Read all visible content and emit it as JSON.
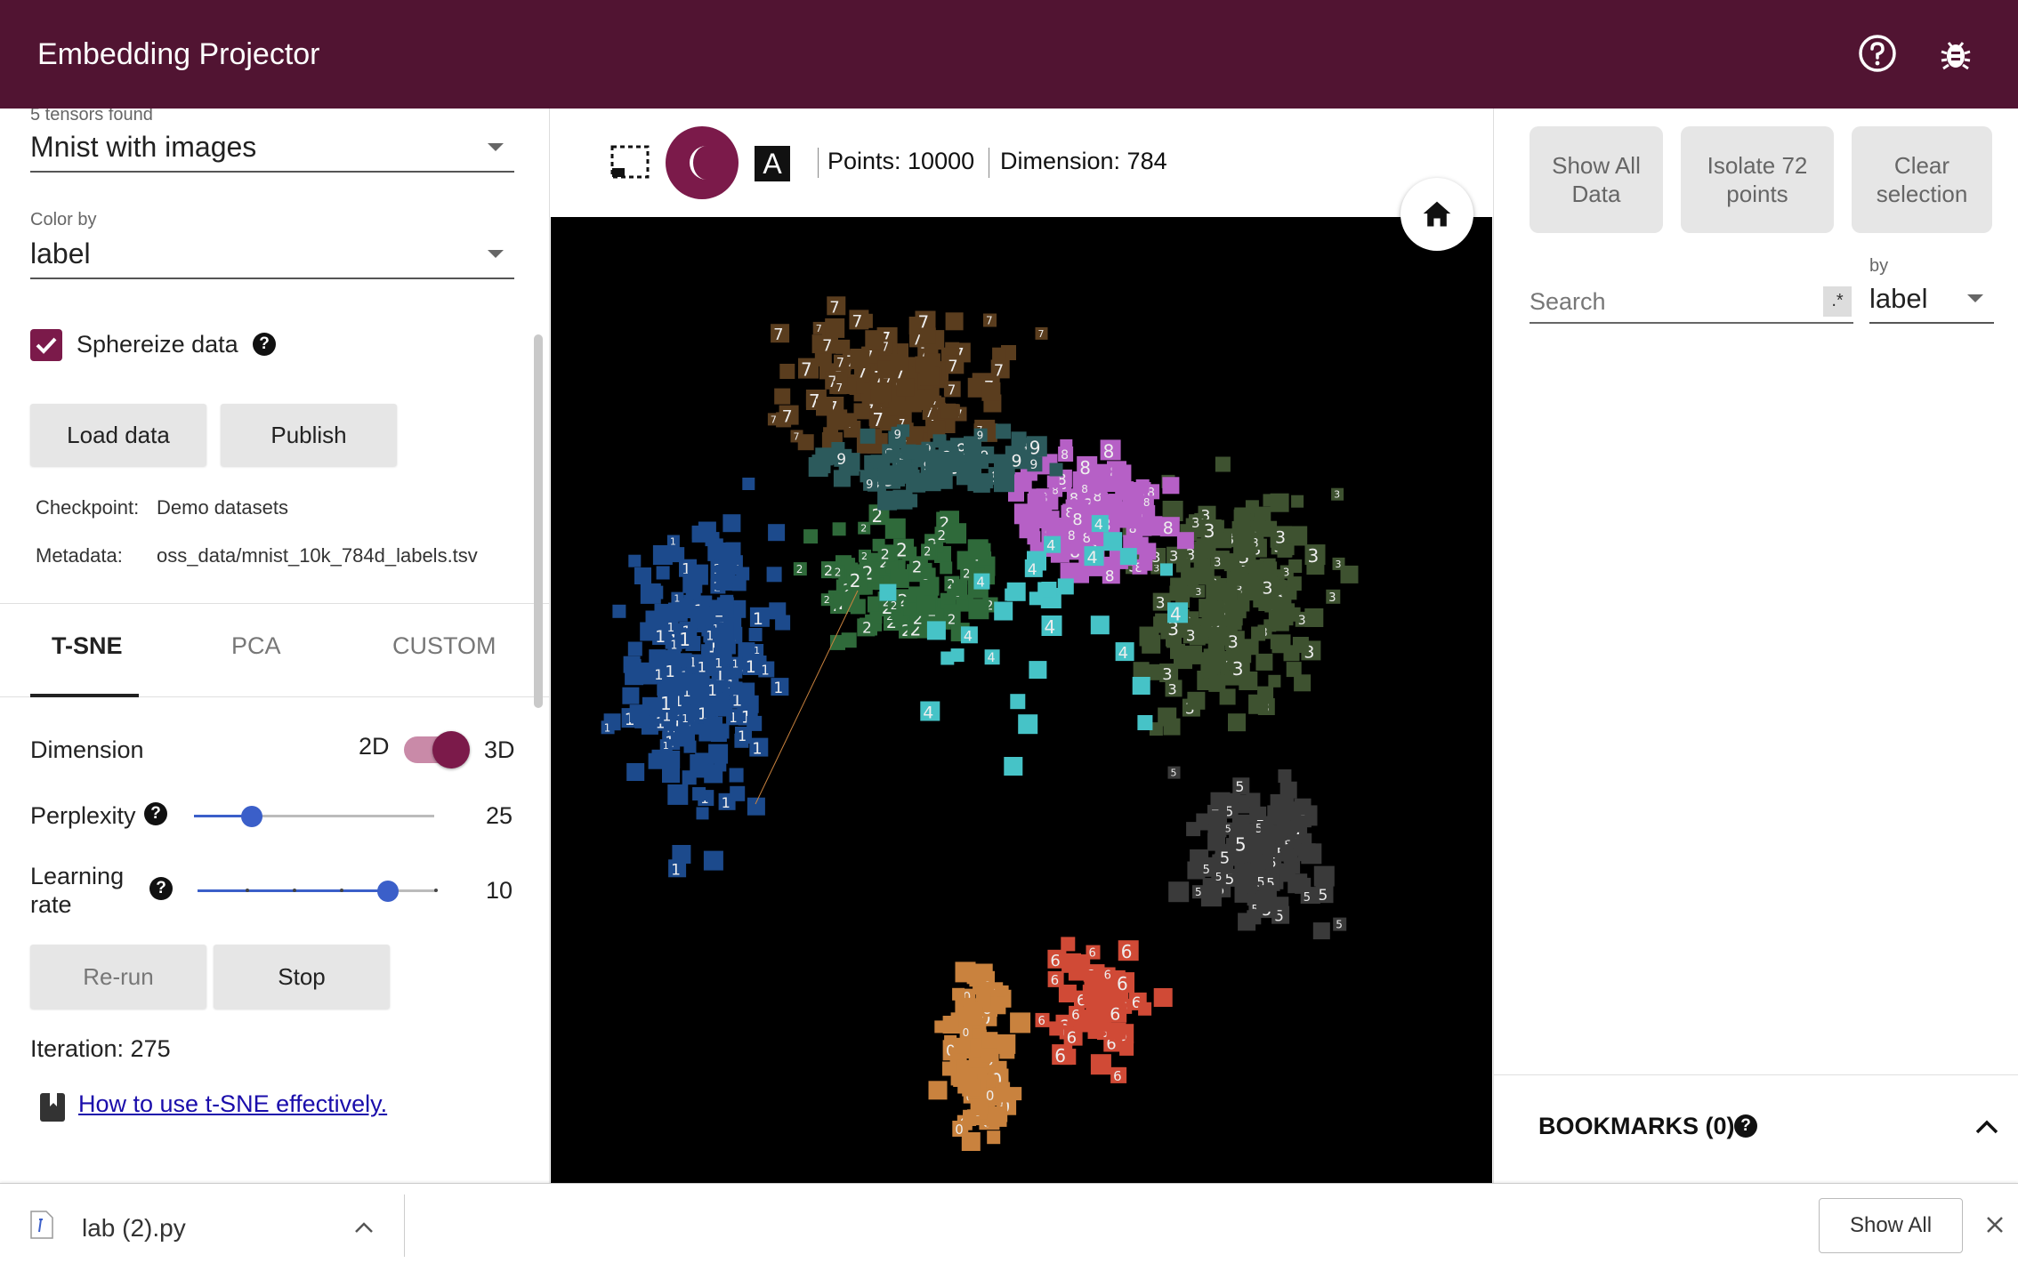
{
  "header": {
    "title": "Embedding Projector",
    "help_icon": "help-circle-icon",
    "bug_icon": "bug-icon"
  },
  "left": {
    "tensors_found": "5 tensors found",
    "tensor_select": "Mnist with images",
    "color_by_label": "Color by",
    "color_by_value": "label",
    "sphereize_label": "Sphereize data",
    "sphereize_checked": true,
    "load_button": "Load data",
    "publish_button": "Publish",
    "checkpoint_label": "Checkpoint:",
    "checkpoint_value": "Demo datasets",
    "metadata_label": "Metadata:",
    "metadata_value": "oss_data/mnist_10k_784d_labels.tsv",
    "tabs": [
      {
        "label": "T-SNE",
        "active": true
      },
      {
        "label": "PCA"
      },
      {
        "label": "CUSTOM"
      }
    ],
    "dimension_label": "Dimension",
    "dim_2d": "2D",
    "dim_3d": "3D",
    "dimension_3d_on": true,
    "perplexity_label": "Perplexity",
    "perplexity_value": "25",
    "perplexity_fraction": 0.24,
    "learning_rate_label_1": "Learning",
    "learning_rate_label_2": "rate",
    "learning_rate_value": "10",
    "learning_rate_fraction": 0.8,
    "rerun_button": "Re-run",
    "stop_button": "Stop",
    "iteration": "Iteration: 275",
    "tsne_link": "How to use t-SNE effectively."
  },
  "center": {
    "points": "Points: 10000",
    "dimension": "Dimension: 784",
    "night_mode_on": true,
    "accent": "#7b1a4a"
  },
  "right": {
    "show_all": [
      "Show All",
      "Data"
    ],
    "isolate": [
      "Isolate 72",
      "points"
    ],
    "clear": [
      "Clear",
      "selection"
    ],
    "search_placeholder": "Search",
    "regex": ".*",
    "by_label": "by",
    "by_value": "label",
    "bookmarks": "BOOKMARKS (0)"
  },
  "download_bar": {
    "file": "lab (2).py",
    "show_all": "Show All"
  },
  "colors": {
    "header": "#511432",
    "brand": "#7b1a4a",
    "slider": "#3b5fc9"
  }
}
